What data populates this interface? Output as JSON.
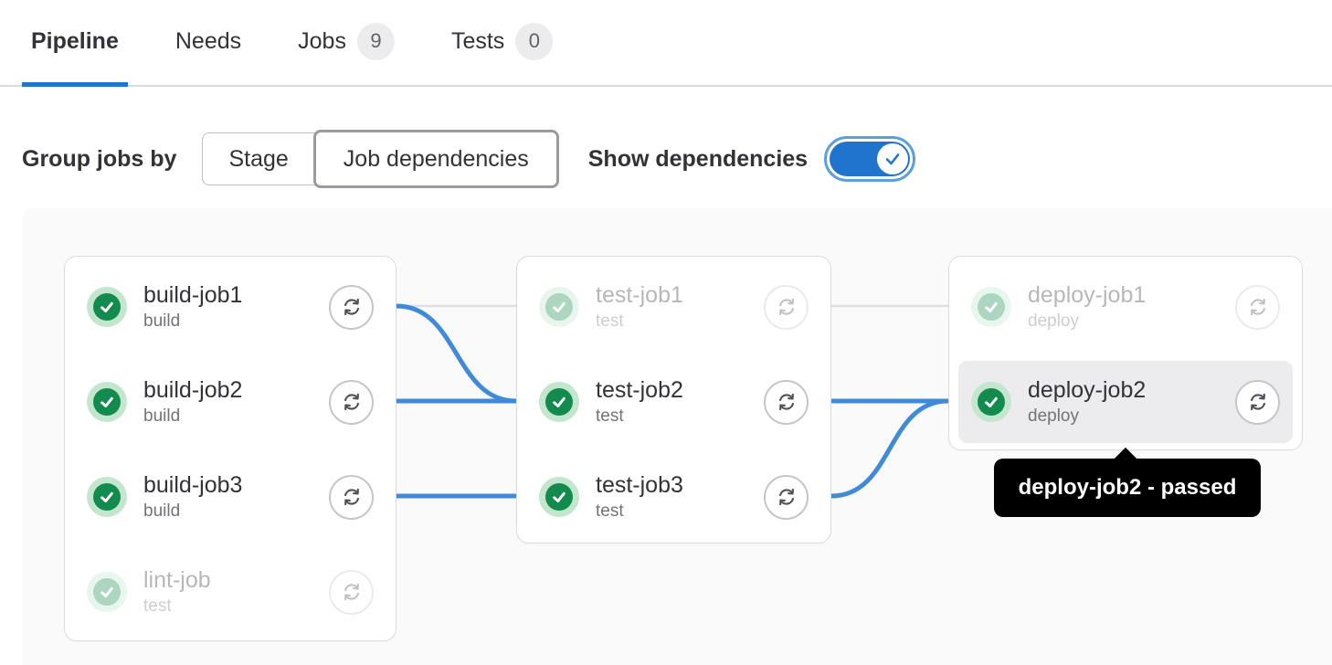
{
  "tabs": [
    {
      "label": "Pipeline",
      "active": true
    },
    {
      "label": "Needs",
      "active": false
    },
    {
      "label": "Jobs",
      "badge": "9",
      "active": false
    },
    {
      "label": "Tests",
      "badge": "0",
      "active": false
    }
  ],
  "controls": {
    "group_label": "Group jobs by",
    "options": [
      {
        "label": "Stage",
        "selected": false
      },
      {
        "label": "Job dependencies",
        "selected": true
      }
    ],
    "show_dependencies_label": "Show dependencies",
    "toggle_state": "on"
  },
  "graph": {
    "columns": [
      {
        "jobs": [
          {
            "name": "build-job1",
            "stage": "build",
            "status": "passed",
            "faded": false
          },
          {
            "name": "build-job2",
            "stage": "build",
            "status": "passed",
            "faded": false
          },
          {
            "name": "build-job3",
            "stage": "build",
            "status": "passed",
            "faded": false
          },
          {
            "name": "lint-job",
            "stage": "test",
            "status": "passed",
            "faded": true
          }
        ]
      },
      {
        "jobs": [
          {
            "name": "test-job1",
            "stage": "test",
            "status": "passed",
            "faded": true
          },
          {
            "name": "test-job2",
            "stage": "test",
            "status": "passed",
            "faded": false
          },
          {
            "name": "test-job3",
            "stage": "test",
            "status": "passed",
            "faded": false
          }
        ]
      },
      {
        "jobs": [
          {
            "name": "deploy-job1",
            "stage": "deploy",
            "status": "passed",
            "faded": true
          },
          {
            "name": "deploy-job2",
            "stage": "deploy",
            "status": "passed",
            "faded": false,
            "highlighted": true
          }
        ]
      }
    ],
    "dependencies_highlighted": [
      "build-job1 -> test-job2",
      "build-job2 -> test-job2",
      "build-job3 -> test-job3",
      "test-job2 -> deploy-job2",
      "test-job3 -> deploy-job2"
    ],
    "dependencies_dimmed": [
      "build-job1 -> test-job1",
      "test-job1 -> deploy-job1"
    ],
    "tooltip": {
      "text": "deploy-job2 - passed"
    }
  },
  "colors": {
    "accent_blue": "#1f75cb",
    "link_blue": "#418bd6",
    "success_green": "#148b4e",
    "success_halo": "#c3e6cd",
    "dim_line": "#dfdfe3",
    "card_border": "#dcdcde",
    "highlight_row": "#ececef",
    "badge_bg": "#ececef",
    "tooltip_bg": "#000000"
  }
}
